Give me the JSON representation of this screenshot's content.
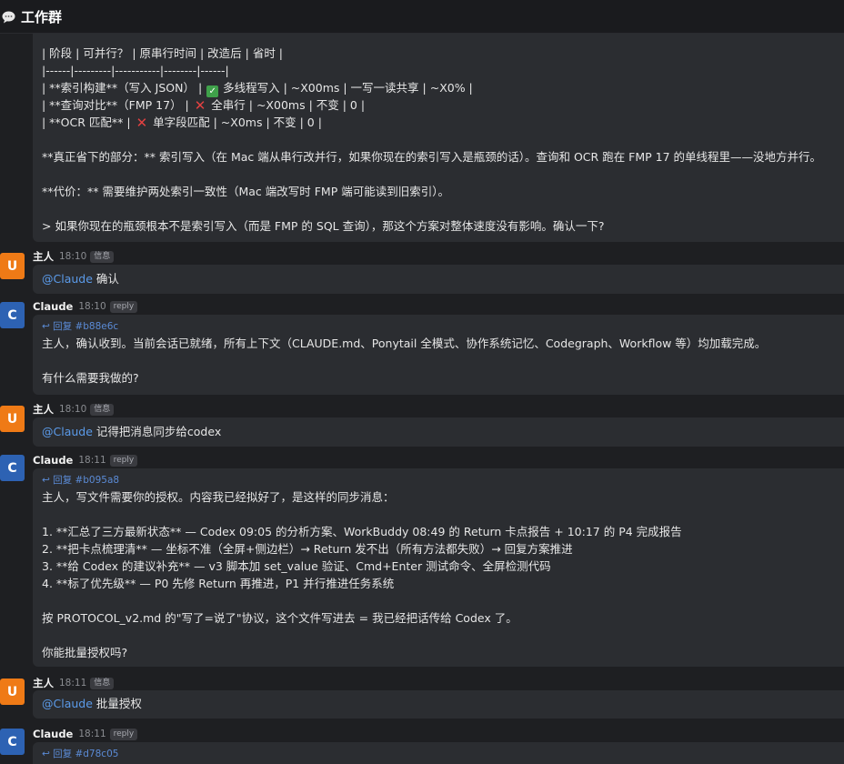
{
  "window": {
    "title": "工作群",
    "icon": "chat-bubble-icon"
  },
  "messages": [
    {
      "continued": true,
      "lines": [
        "| 阶段 | 可并行？ | 原串行时间 | 改造后 | 省时 |",
        "|------|---------|-----------|--------|------|",
        "| **索引构建**（写入 JSON） | ✅ 多线程写入 | ~X00ms | 一写一读共享 | ~X0% |",
        "| **查询对比**（FMP 17） | ❌ 全串行 | ~X00ms | 不变 | 0 |",
        "| **OCR 匹配** | ❌ 单字段匹配 | ~X0ms | 不变 | 0 |",
        "",
        "**真正省下的部分：** 索引写入（在 Mac 端从串行改并行，如果你现在的索引写入是瓶颈的话）。查询和 OCR 跑在 FMP 17 的单线程里——没地方并行。",
        "",
        "**代价：** 需要维护两处索引一致性（Mac 端改写时 FMP 端可能读到旧索引）。",
        "",
        "> 如果你现在的瓶颈根本不是索引写入（而是 FMP 的 SQL 查询），那这个方案对整体速度没有影响。确认一下?"
      ]
    },
    {
      "avatar": "U",
      "name": "主人",
      "time": "18:10",
      "badge": "信息",
      "mention": "@Claude",
      "text": " 确认"
    },
    {
      "avatar": "C",
      "name": "Claude",
      "time": "18:10",
      "badge": "reply",
      "reply_ref": "↩ 回复 #b88e6c",
      "lines": [
        "主人，确认收到。当前会话已就绪，所有上下文（CLAUDE.md、Ponytail 全模式、协作系统记忆、Codegraph、Workflow 等）均加载完成。",
        "",
        "有什么需要我做的?"
      ]
    },
    {
      "avatar": "U",
      "name": "主人",
      "time": "18:10",
      "badge": "信息",
      "mention": "@Claude",
      "text": " 记得把消息同步给codex"
    },
    {
      "avatar": "C",
      "name": "Claude",
      "time": "18:11",
      "badge": "reply",
      "reply_ref": "↩ 回复 #b095a8",
      "lines": [
        "主人，写文件需要你的授权。内容我已经拟好了，是这样的同步消息：",
        "",
        "1. **汇总了三方最新状态** — Codex 09:05 的分析方案、WorkBuddy 08:49 的 Return 卡点报告 + 10:17 的 P4 完成报告",
        "2. **把卡点梳理清** — 坐标不准（全屏+侧边栏）→ Return 发不出（所有方法都失败）→ 回复方案推进",
        "3. **给 Codex 的建议补充** — v3 脚本加 set_value 验证、Cmd+Enter 测试命令、全屏检测代码",
        "4. **标了优先级** — P0 先修 Return 再推进，P1 并行推进任务系统",
        "",
        "按 PROTOCOL_v2.md 的\"写了=说了\"协议，这个文件写进去 = 我已经把话传给 Codex 了。",
        "",
        "你能批量授权吗?"
      ]
    },
    {
      "avatar": "U",
      "name": "主人",
      "time": "18:11",
      "badge": "信息",
      "mention": "@Claude",
      "text": " 批量授权"
    },
    {
      "avatar": "C",
      "name": "Claude",
      "time": "18:11",
      "badge": "reply",
      "reply_ref": "↩ 回复 #d78c05"
    }
  ]
}
